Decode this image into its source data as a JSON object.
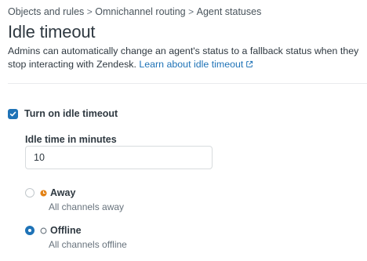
{
  "breadcrumb": {
    "items": [
      "Objects and rules",
      "Omnichannel routing",
      "Agent statuses"
    ],
    "separator": ">"
  },
  "page": {
    "title": "Idle timeout",
    "description": "Admins can automatically change an agent's status to a fallback status when they stop interacting with Zendesk.",
    "learn_more": "Learn about idle timeout"
  },
  "toggle": {
    "label": "Turn on idle timeout",
    "checked": true
  },
  "idle_time": {
    "label": "Idle time in minutes",
    "value": "10"
  },
  "statuses": [
    {
      "label": "Away",
      "hint": "All channels away",
      "selected": false,
      "icon": "away-clock-icon",
      "color": "#e38215"
    },
    {
      "label": "Offline",
      "hint": "All channels offline",
      "selected": true,
      "icon": "offline-circle-icon",
      "color": "#68737d"
    }
  ],
  "colors": {
    "accent": "#1f73b7",
    "text": "#2f3941",
    "muted": "#68737d"
  }
}
